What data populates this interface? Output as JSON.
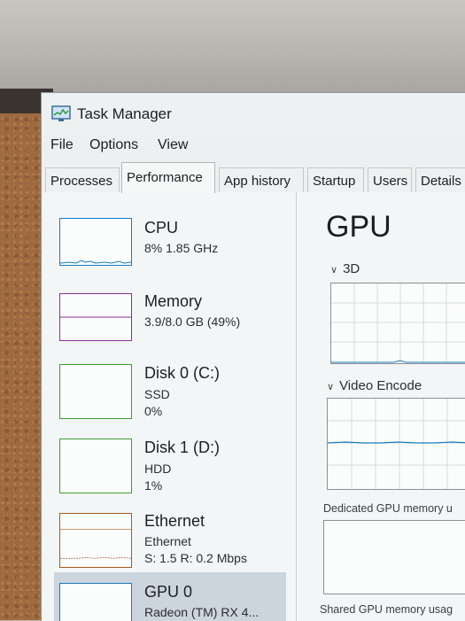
{
  "window": {
    "title": "Task Manager"
  },
  "menu": [
    "File",
    "Options",
    "View"
  ],
  "tabs": [
    "Processes",
    "Performance",
    "App history",
    "Startup",
    "Users",
    "Details"
  ],
  "active_tab": "Performance",
  "sidebar": {
    "items": [
      {
        "title": "CPU",
        "line1": "8% 1.85 GHz",
        "line2": "",
        "color": "#1a7bbd"
      },
      {
        "title": "Memory",
        "line1": "3.9/8.0 GB (49%)",
        "line2": "",
        "color": "#8b2f99"
      },
      {
        "title": "Disk 0 (C:)",
        "line1": "SSD",
        "line2": "0%",
        "color": "#3c9c32"
      },
      {
        "title": "Disk 1 (D:)",
        "line1": "HDD",
        "line2": "1%",
        "color": "#3c9c32"
      },
      {
        "title": "Ethernet",
        "line1": "Ethernet",
        "line2": "S: 1.5 R: 0.2 Mbps",
        "color": "#a55a22"
      },
      {
        "title": "GPU 0",
        "line1": "Radeon (TM) RX 4...",
        "line2": "",
        "color": "#1a7bbd"
      }
    ]
  },
  "main": {
    "heading": "GPU",
    "graph1": "3D",
    "graph2": "Video Encode",
    "dedicated": "Dedicated GPU memory u",
    "shared": "Shared GPU memory usag"
  }
}
